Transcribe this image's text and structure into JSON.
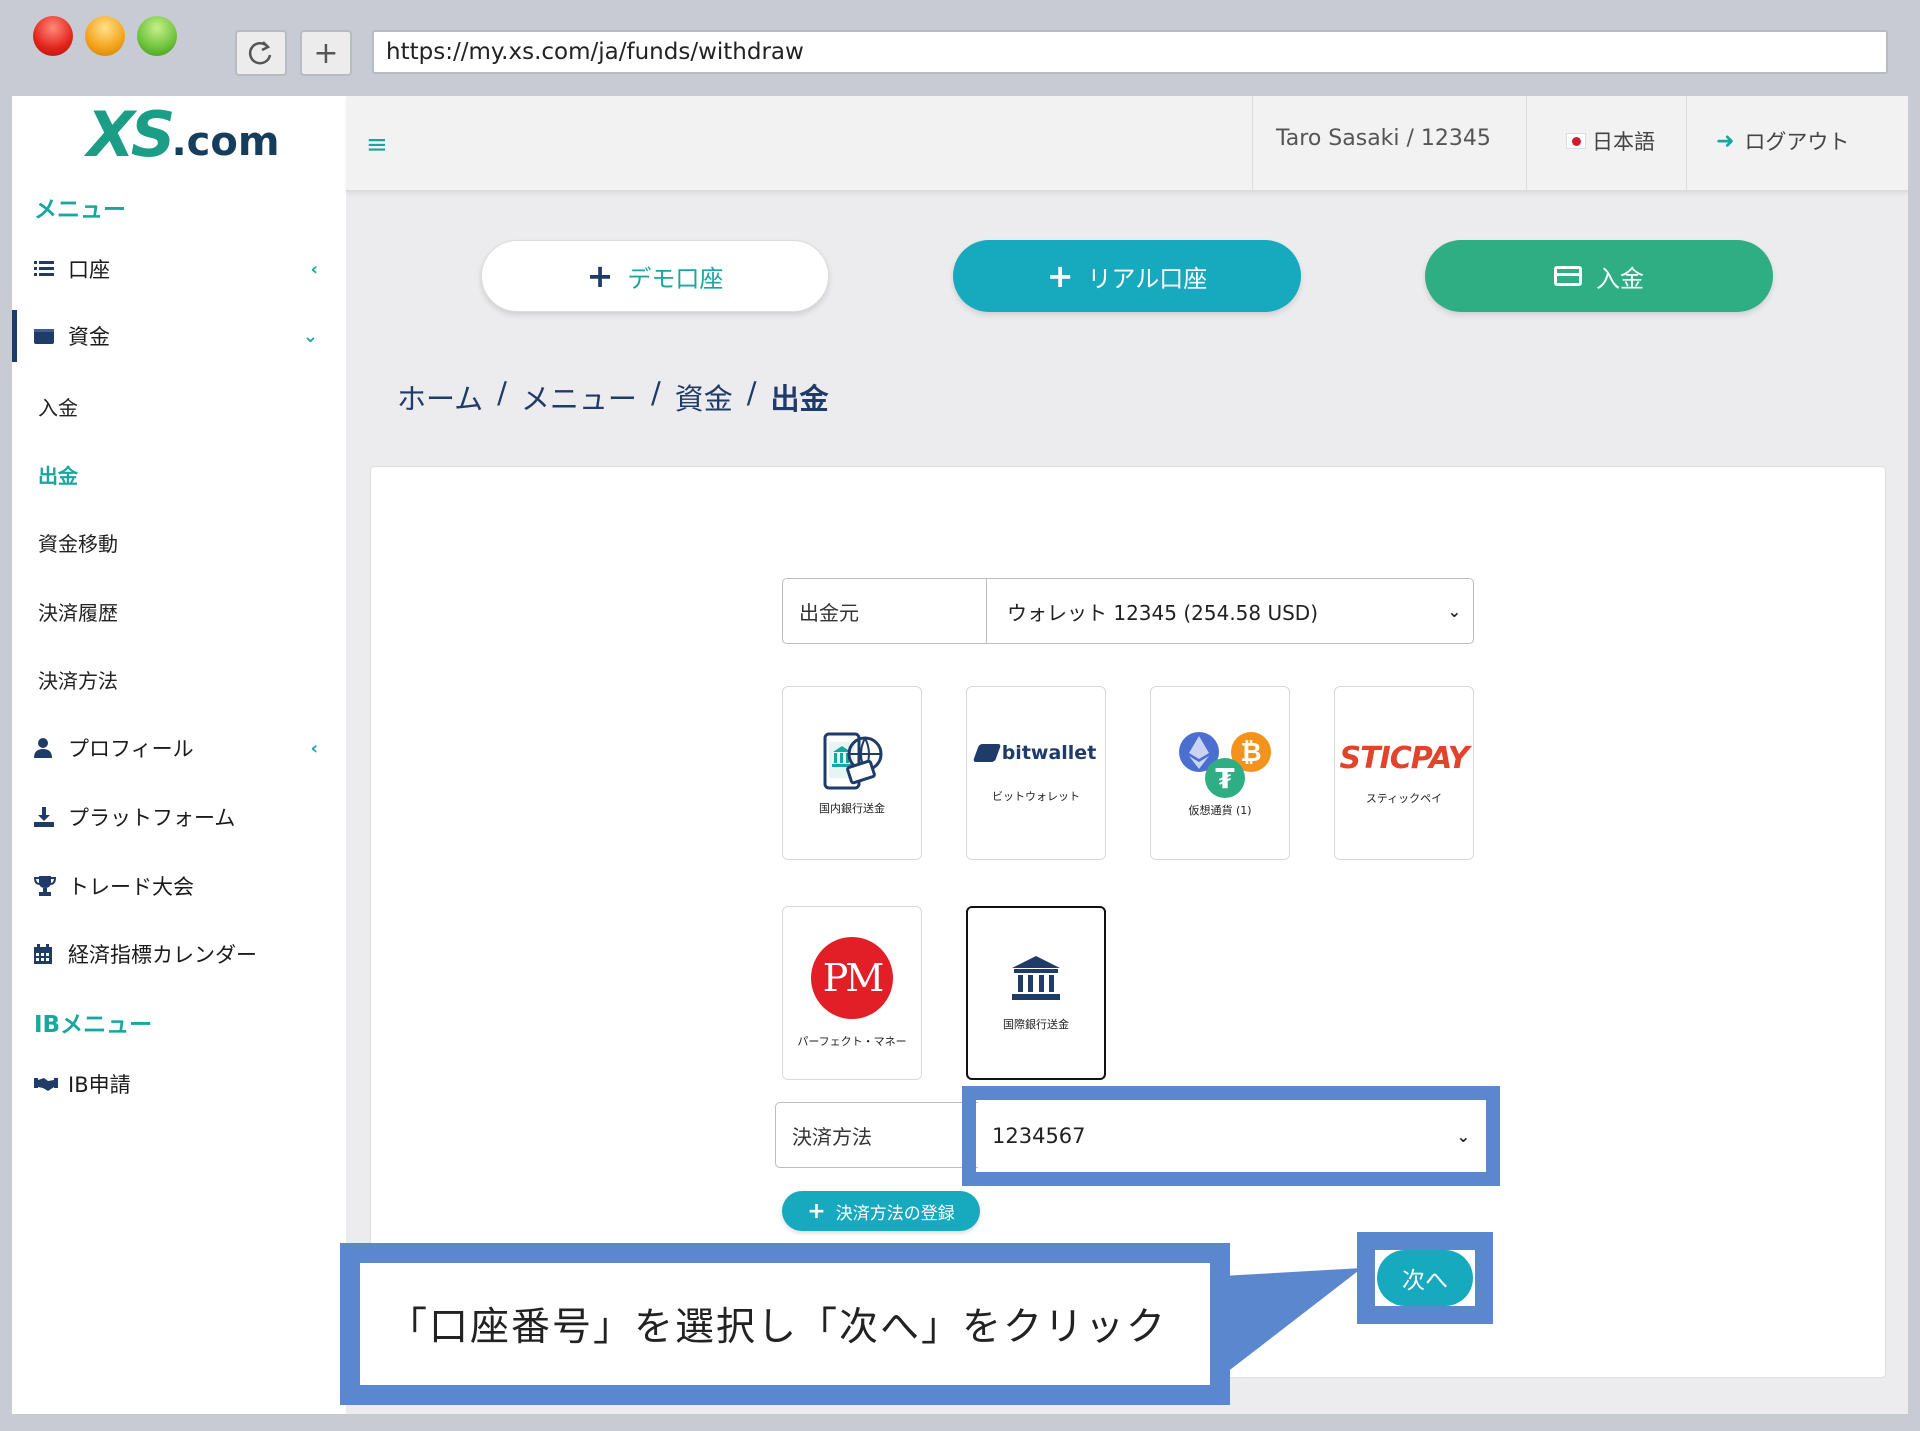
{
  "browser": {
    "url": "https://my.xs.com/ja/funds/withdraw",
    "reload_icon": "reload-icon",
    "new_tab_icon": "plus-icon"
  },
  "logo": {
    "xs": "XS",
    "com": ".com"
  },
  "sidebar": {
    "menu_title": "メニュー",
    "items": [
      {
        "label": "口座",
        "icon": "list-icon"
      },
      {
        "label": "資金",
        "icon": "wallet-icon"
      },
      {
        "label": "プロフィール",
        "icon": "user-icon"
      },
      {
        "label": "プラットフォーム",
        "icon": "download-icon"
      },
      {
        "label": "トレード大会",
        "icon": "trophy-icon"
      },
      {
        "label": "経済指標カレンダー",
        "icon": "calendar-icon"
      }
    ],
    "sub_items": [
      "入金",
      "出金",
      "資金移動",
      "決済履歴",
      "決済方法"
    ],
    "ib_title": "IBメニュー",
    "ib_items": [
      {
        "label": "IB申請",
        "icon": "handshake-icon"
      }
    ]
  },
  "topbar": {
    "user": "Taro Sasaki / 12345",
    "language": "日本語",
    "logout": "ログアウト"
  },
  "actions": {
    "demo": "デモ口座",
    "real": "リアル口座",
    "deposit": "入金"
  },
  "breadcrumb": [
    "ホーム",
    "メニュー",
    "資金",
    "出金"
  ],
  "form": {
    "source_label": "出金元",
    "source_value": "ウォレット 12345 (254.58 USD)",
    "methods": [
      {
        "caption": "国内銀行送金",
        "icon": "bank-transfer-icon"
      },
      {
        "caption": "ビットウォレット",
        "logo_a": "bit",
        "logo_b": "wallet"
      },
      {
        "caption": "仮想通貨 (1)",
        "icon": "crypto-icon"
      },
      {
        "caption": "スティックペイ",
        "logo": "STICPAY"
      },
      {
        "caption": "パーフェクト・マネー",
        "logo": "PM"
      },
      {
        "caption": "国際銀行送金",
        "icon": "bank-icon"
      }
    ],
    "payment_label": "決済方法",
    "payment_value": "1234567",
    "register_label": "決済方法の登録",
    "next_label": "次へ"
  },
  "callout": "「口座番号」を選択し「次へ」をクリック",
  "colors": {
    "teal": "#17a7a0",
    "cyan": "#17a9be",
    "green": "#2fae83",
    "navy": "#1f3b68",
    "highlight": "#5b87cf"
  }
}
